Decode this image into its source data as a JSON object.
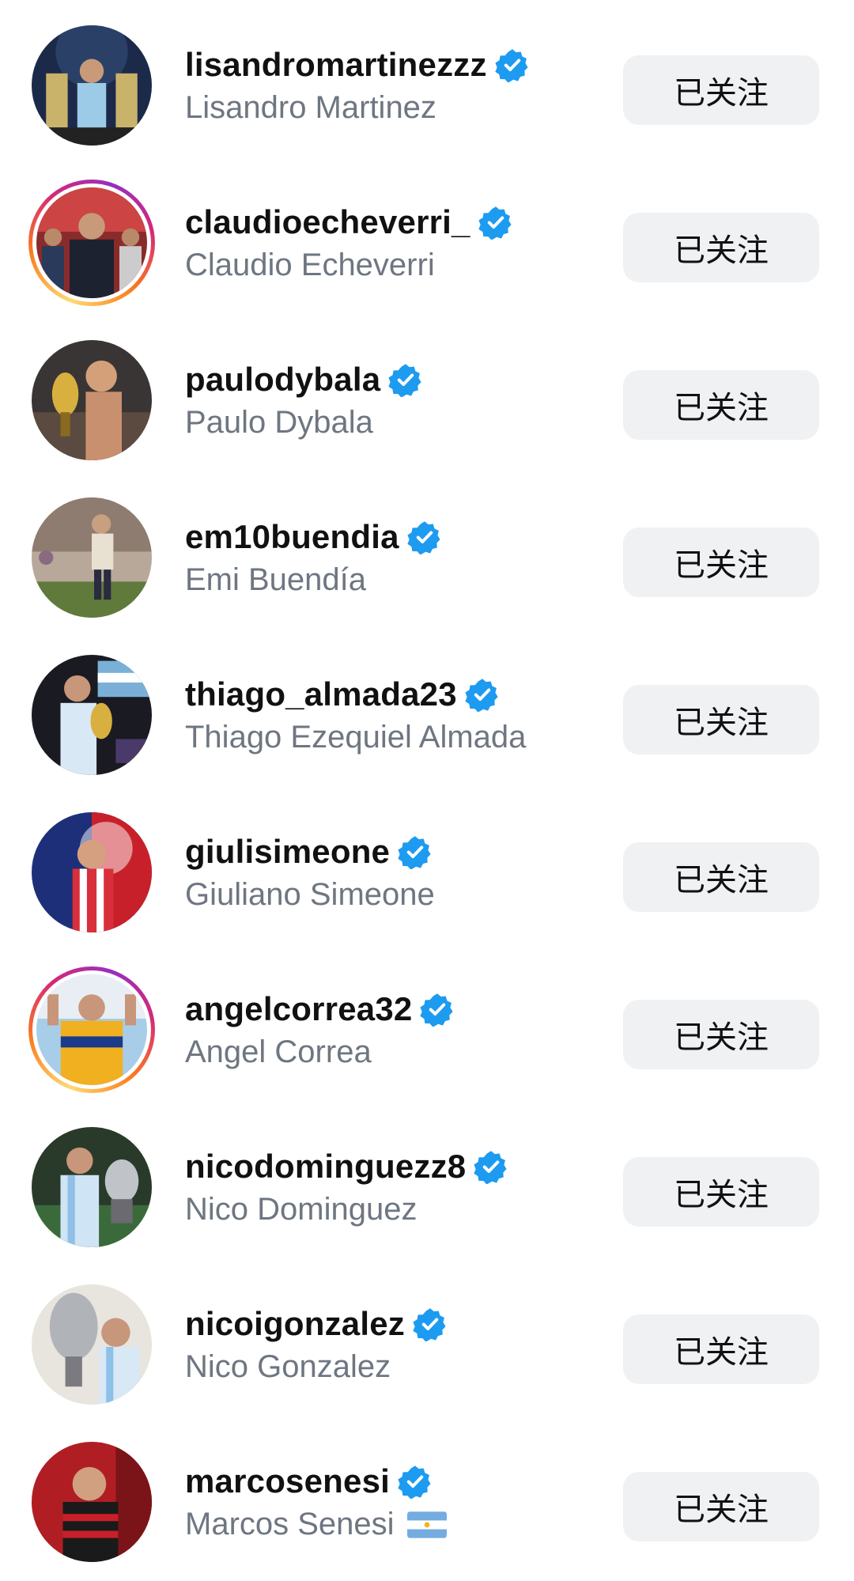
{
  "following": [
    {
      "username": "lisandromartinezzz",
      "fullname": "Lisandro Martinez",
      "verified": true,
      "story_ring": false,
      "button": "已关注"
    },
    {
      "username": "claudioecheverri_",
      "fullname": "Claudio Echeverri",
      "verified": true,
      "story_ring": true,
      "button": "已关注"
    },
    {
      "username": "paulodybala",
      "fullname": "Paulo Dybala",
      "verified": true,
      "story_ring": false,
      "button": "已关注"
    },
    {
      "username": "em10buendia",
      "fullname": "Emi Buendía",
      "verified": true,
      "story_ring": false,
      "button": "已关注"
    },
    {
      "username": "thiago_almada23",
      "fullname": "Thiago Ezequiel Almada",
      "verified": true,
      "story_ring": false,
      "button": "已关注"
    },
    {
      "username": "giulisimeone",
      "fullname": "Giuliano Simeone",
      "verified": true,
      "story_ring": false,
      "button": "已关注"
    },
    {
      "username": "angelcorrea32",
      "fullname": "Angel Correa",
      "verified": true,
      "story_ring": true,
      "button": "已关注"
    },
    {
      "username": "nicodominguezz8",
      "fullname": "Nico Dominguez",
      "verified": true,
      "story_ring": false,
      "button": "已关注"
    },
    {
      "username": "nicoigonzalez",
      "fullname": "Nico Gonzalez",
      "verified": true,
      "story_ring": false,
      "button": "已关注"
    },
    {
      "username": "marcosenesi",
      "fullname": "Marcos Senesi",
      "verified": true,
      "story_ring": false,
      "button": "已关注",
      "flag_icon": "argentina-flag-icon"
    }
  ],
  "colors": {
    "verified_badge": "#1d9bf0",
    "username": "#111111",
    "fullname": "#6e7681",
    "button_bg": "#eff1f3"
  }
}
